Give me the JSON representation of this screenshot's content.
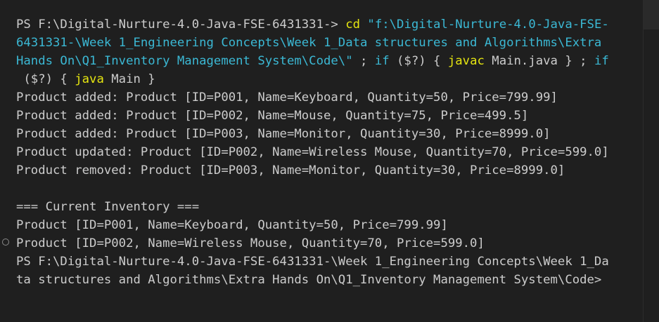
{
  "command": {
    "prompt": "PS F:\\Digital-Nurture-4.0-Java-FSE-6431331-> ",
    "cd": "cd",
    "path_line1": "\"f:\\Digital-Nurture-4.0-Java-FSE-",
    "path_line2": "6431331-\\Week 1_Engineering Concepts\\Week 1_Data structures and Algorithms\\Extra",
    "path_line3": "Hands On\\Q1_Inventory Management System\\Code\\\"",
    "sep1": " ; ",
    "if1": "if",
    "cond1": " ($?)",
    "brace_open1": " { ",
    "javac": "javac",
    "javac_arg": " Main.java } ; ",
    "if2": "if",
    "line4_lead": " ",
    "cond2": "($?)",
    "brace_open2": " { ",
    "java": "java",
    "java_arg": " Main }"
  },
  "output": [
    "Product added: Product [ID=P001, Name=Keyboard, Quantity=50, Price=799.99]",
    "Product added: Product [ID=P002, Name=Mouse, Quantity=75, Price=499.5]",
    "Product added: Product [ID=P003, Name=Monitor, Quantity=30, Price=8999.0]",
    "Product updated: Product [ID=P002, Name=Wireless Mouse, Quantity=70, Price=599.0]",
    "Product removed: Product [ID=P003, Name=Monitor, Quantity=30, Price=8999.0]",
    "",
    "=== Current Inventory ===",
    "Product [ID=P001, Name=Keyboard, Quantity=50, Price=799.99]",
    "Product [ID=P002, Name=Wireless Mouse, Quantity=70, Price=599.0]"
  ],
  "final_prompt": {
    "line1": "PS F:\\Digital-Nurture-4.0-Java-FSE-6431331-\\Week 1_Engineering Concepts\\Week 1_Da",
    "line2": "ta structures and Algorithms\\Extra Hands On\\Q1_Inventory Management System\\Code>"
  },
  "colors": {
    "background": "#1f1f1f",
    "foreground": "#cccccc",
    "cyan": "#3bb8d4",
    "yellow": "#e5e510"
  }
}
